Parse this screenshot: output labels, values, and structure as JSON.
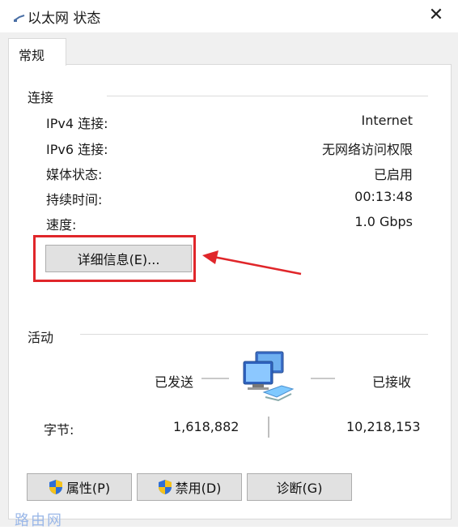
{
  "window": {
    "title": "以太网 状态",
    "close_icon": "✕"
  },
  "tab": {
    "label": "常规"
  },
  "connection": {
    "title": "连接",
    "rows": [
      {
        "label": "IPv4 连接:",
        "value": "Internet"
      },
      {
        "label": "IPv6 连接:",
        "value": "无网络访问权限"
      },
      {
        "label": "媒体状态:",
        "value": "已启用"
      },
      {
        "label": "持续时间:",
        "value": "00:13:48"
      },
      {
        "label": "速度:",
        "value": "1.0 Gbps"
      }
    ],
    "details_button": "详细信息(E)..."
  },
  "activity": {
    "title": "活动",
    "sent_label": "已发送",
    "received_label": "已接收",
    "bytes_label": "字节:",
    "bytes_sent": "1,618,882",
    "bytes_received": "10,218,153"
  },
  "buttons": {
    "properties": "属性(P)",
    "disable": "禁用(D)",
    "diagnose": "诊断(G)"
  },
  "colors": {
    "highlight": "#e0262a",
    "arrow": "#e0262a"
  },
  "watermark": "路由网"
}
